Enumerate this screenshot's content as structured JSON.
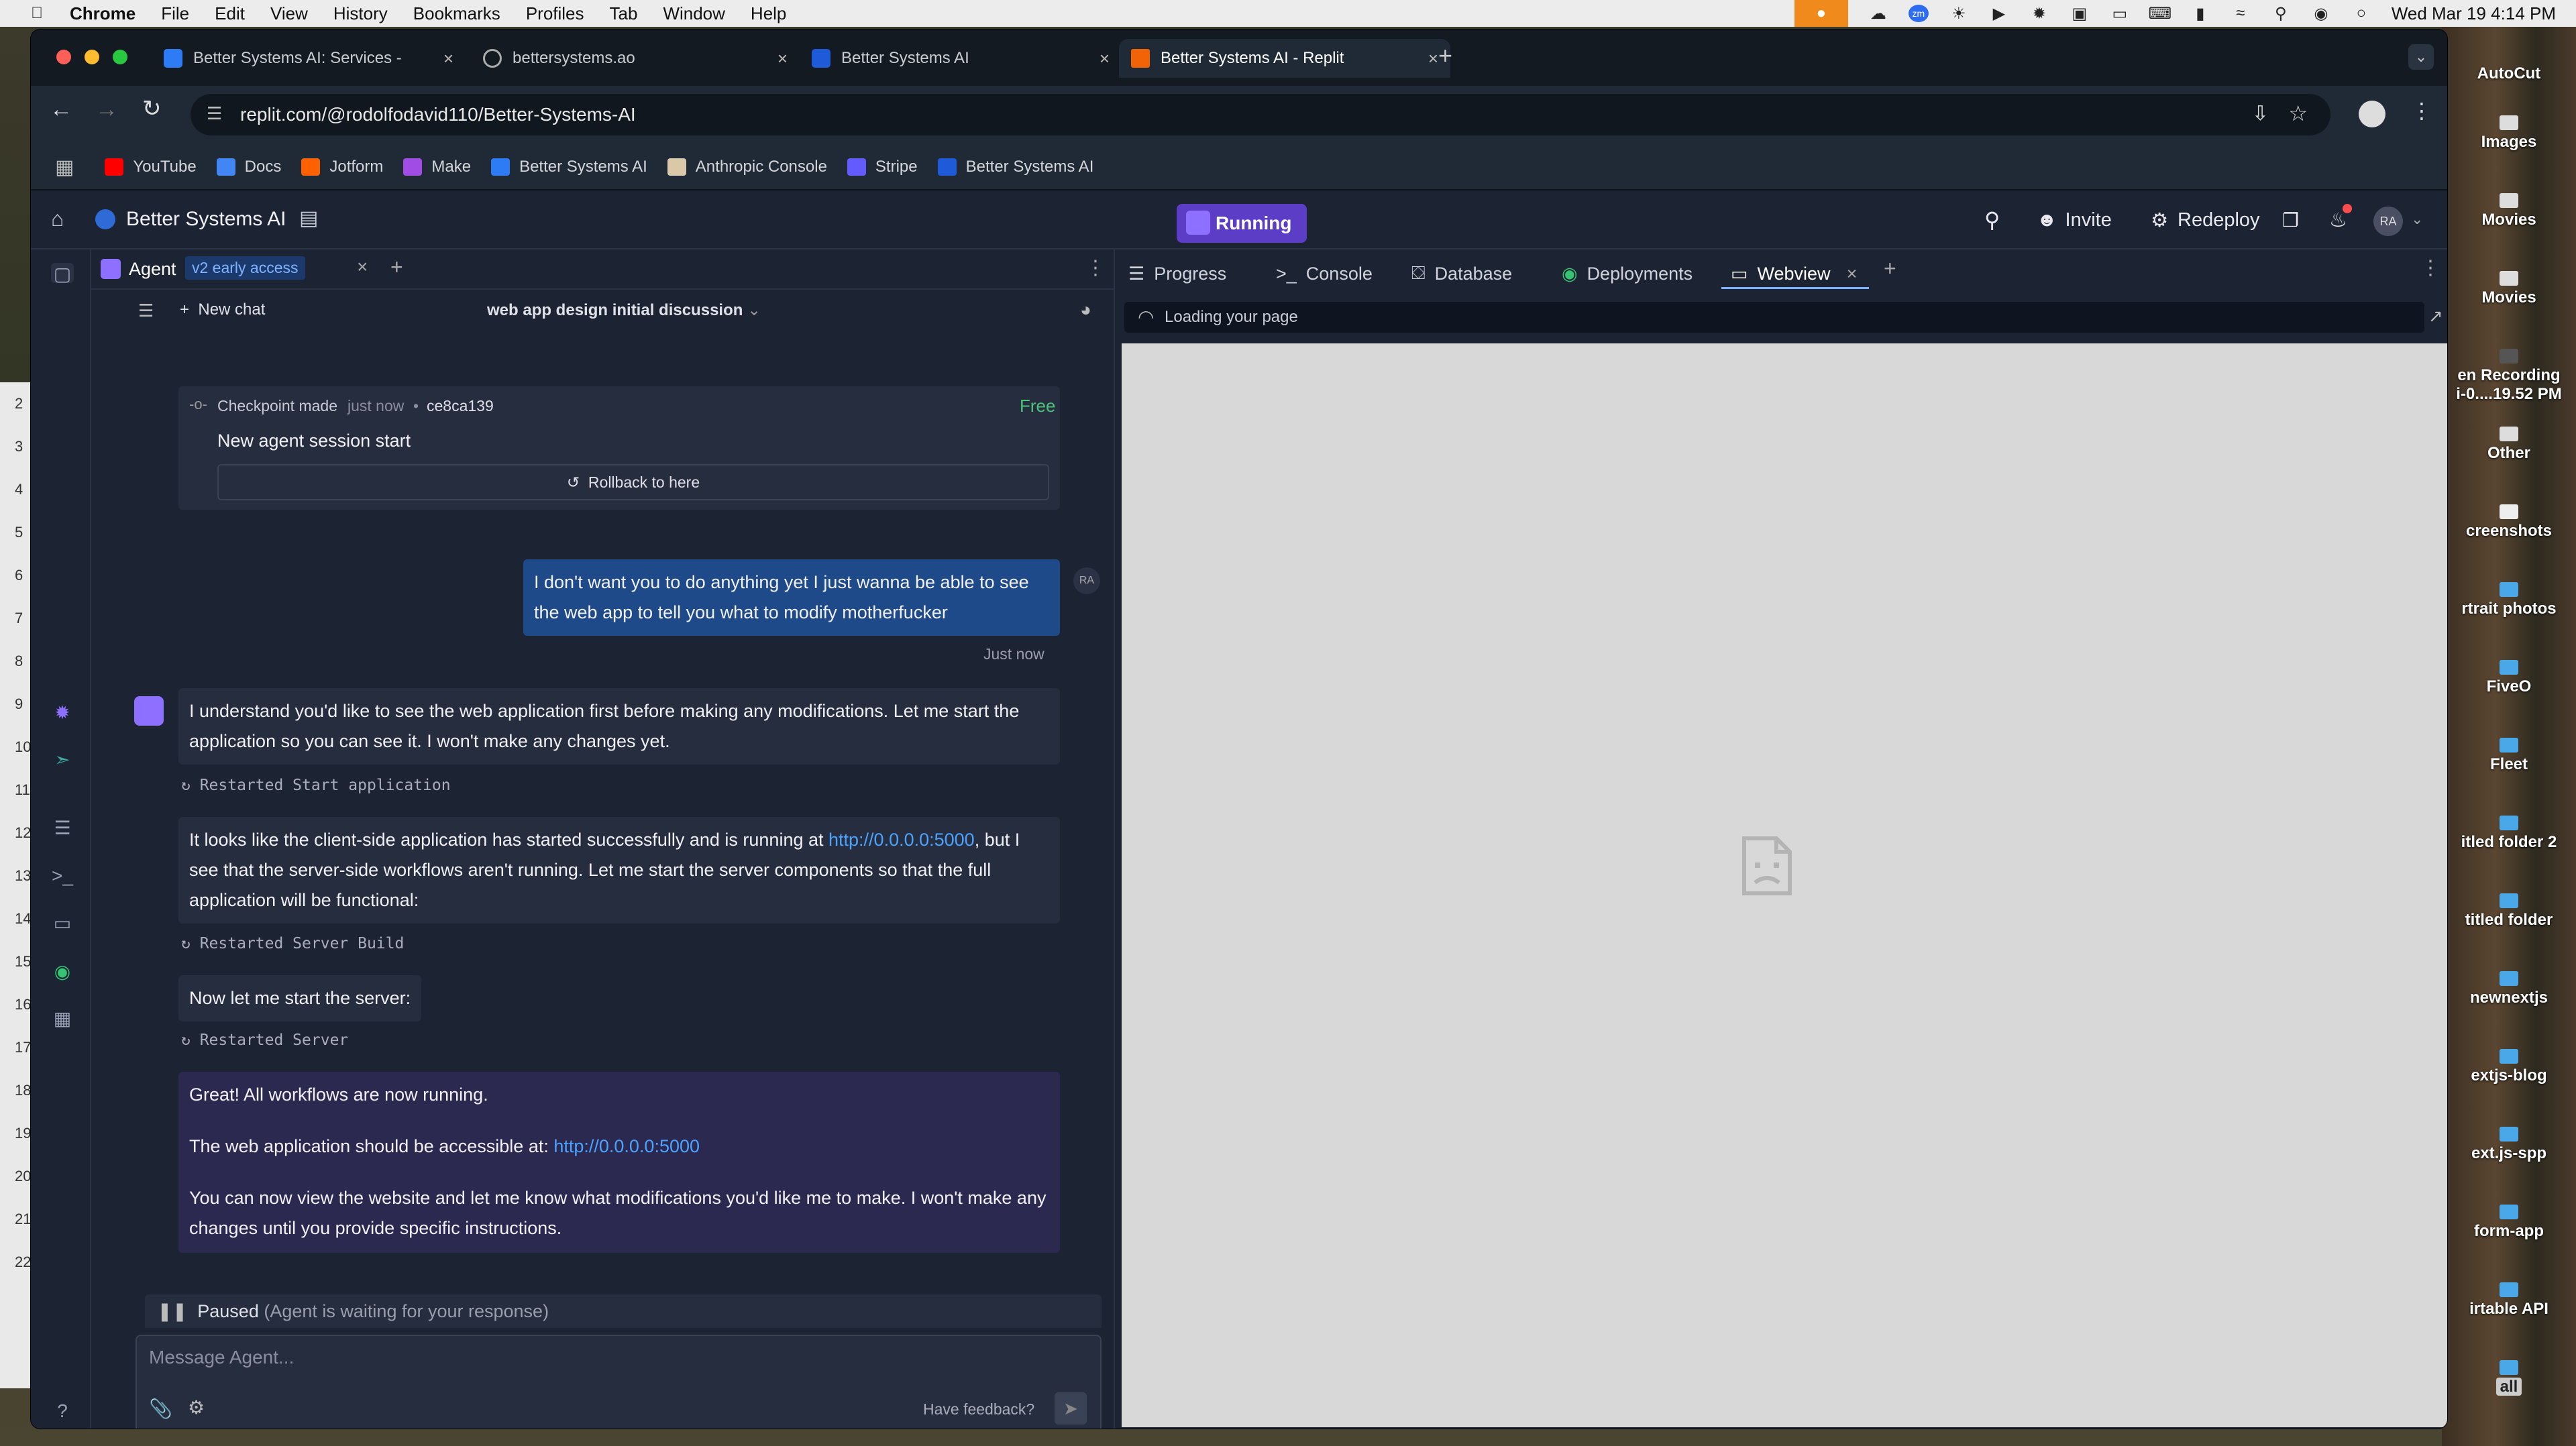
{
  "menubar": {
    "app": "Chrome",
    "items": [
      "File",
      "Edit",
      "View",
      "History",
      "Bookmarks",
      "Profiles",
      "Tab",
      "Window",
      "Help"
    ],
    "datetime": "Wed Mar 19  4:14 PM"
  },
  "desktop": {
    "items": [
      "AutoCut",
      "Images",
      "Movies",
      "Movies",
      "en Recording",
      "i-0....19.52 PM",
      "Other",
      "creenshots",
      "rtrait photos",
      "FiveO",
      "Fleet",
      "itled folder 2",
      "titled folder",
      "newnextjs",
      "extjs-blog",
      "ext.js-spp",
      "form-app",
      "irtable API",
      "all"
    ],
    "behind_numbers": [
      "2",
      "3",
      "4",
      "5",
      "6",
      "7",
      "8",
      "9",
      "10",
      "11",
      "12",
      "13",
      "14",
      "15",
      "16",
      "17",
      "18",
      "19",
      "20",
      "21",
      "22"
    ]
  },
  "browser": {
    "tabs": [
      {
        "title": "Better Systems AI: Services -"
      },
      {
        "title": "bettersystems.ao"
      },
      {
        "title": "Better Systems AI"
      },
      {
        "title": "Better Systems AI - Replit"
      }
    ],
    "url": "replit.com/@rodolfodavid110/Better-Systems-AI",
    "bookmarks": [
      "YouTube",
      "Docs",
      "Jotform",
      "Make",
      "Better Systems AI",
      "Anthropic Console",
      "Stripe",
      "Better Systems AI"
    ]
  },
  "replit": {
    "project": "Better Systems AI",
    "status": "Running",
    "invite": "Invite",
    "redeploy": "Redeploy",
    "avatar": "RA"
  },
  "agent": {
    "tab": "Agent",
    "badge": "v2 early access",
    "new_chat": "New chat",
    "chat_title": "web app design initial discussion",
    "checkpoint": {
      "label": "Checkpoint made",
      "time": "just now",
      "hash": "ce8ca139",
      "price": "Free",
      "title": "New agent session start",
      "rollback": "Rollback to here"
    },
    "user_msg": "I don't want you to do anything yet I just wanna be able to see the web app to tell you what to modify motherfucker",
    "user_avatar": "RA",
    "user_time": "Just now",
    "msg1": "I understand you'd like to see the web application first before making any modifications. Let me start the application so you can see it. I won't make any changes yet.",
    "restart1": "Restarted Start application",
    "msg2_a": "It looks like the client-side application has started successfully and is running at ",
    "msg2_link": "http://0.0.0.0:5000",
    "msg2_b": ", but I see that the server-side workflows aren't running. Let me start the server components so that the full application will be functional:",
    "restart2": "Restarted Server Build",
    "msg3": "Now let me start the server:",
    "restart3": "Restarted Server",
    "msg4_l1": "Great! All workflows are now running.",
    "msg4_l2": "The web application should be accessible at: ",
    "msg4_link": "http://0.0.0.0:5000",
    "msg4_l3": "You can now view the website and let me know what modifications you'd like me to make. I won't make any changes until you provide specific instructions.",
    "paused": "Paused",
    "paused_note": "(Agent is waiting for your response)",
    "input_placeholder": "Message Agent...",
    "feedback": "Have feedback?"
  },
  "webview": {
    "tabs": [
      "Progress",
      "Console",
      "Database",
      "Deployments",
      "Webview"
    ],
    "loading": "Loading your page"
  },
  "colors": {
    "accent": "#5b3dc6",
    "link": "#4ba3ff",
    "user_bubble": "#1f4a8a",
    "agent_bubble": "#262d3e"
  }
}
